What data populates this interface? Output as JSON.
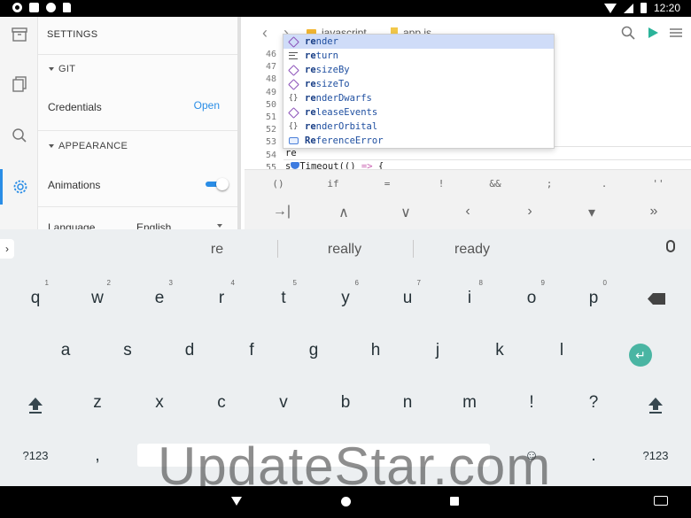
{
  "statusbar": {
    "time": "12:20",
    "icons": [
      "gear-icon",
      "box-icon",
      "circle-icon",
      "clipboard-icon",
      "wifi-icon",
      "cell-signal-icon",
      "battery-icon"
    ]
  },
  "rail": {
    "items": [
      "archive-icon",
      "files-icon",
      "search-icon",
      "settings-icon"
    ],
    "active": "settings-icon",
    "accent": "#2a8de6"
  },
  "settings": {
    "title": "SETTINGS",
    "git_header": "GIT",
    "credentials_label": "Credentials",
    "credentials_action": "Open",
    "appearance_header": "APPEARANCE",
    "animations_label": "Animations",
    "animations_on": true,
    "language_label": "Language",
    "language_value": "English"
  },
  "editor": {
    "breadcrumbs": [
      "javascript",
      "app.js"
    ],
    "line_numbers": [
      "46",
      "47",
      "48",
      "49",
      "50",
      "51",
      "52",
      "53",
      "54",
      "55"
    ],
    "current_line": "re",
    "next_line_suffix": "Timeout(() => {",
    "next_line_arrow": "=>",
    "autocomplete": [
      {
        "label": "render",
        "kind": "method"
      },
      {
        "label": "return",
        "kind": "keyword"
      },
      {
        "label": "resizeBy",
        "kind": "method"
      },
      {
        "label": "resizeTo",
        "kind": "method"
      },
      {
        "label": "renderDwarfs",
        "kind": "snippet"
      },
      {
        "label": "releaseEvents",
        "kind": "method"
      },
      {
        "label": "renderOrbital",
        "kind": "snippet"
      },
      {
        "label": "ReferenceError",
        "kind": "class"
      }
    ]
  },
  "symbols": [
    "()",
    "if",
    "=",
    "!",
    "&&",
    ";",
    ".",
    "''"
  ],
  "nav_keys": [
    "→|",
    "∧",
    "∨",
    "‹",
    "›",
    "▾",
    "»"
  ],
  "keyboard": {
    "suggestions": [
      "re",
      "really",
      "ready"
    ],
    "row1": [
      {
        "k": "q",
        "h": "1"
      },
      {
        "k": "w",
        "h": "2"
      },
      {
        "k": "e",
        "h": "3"
      },
      {
        "k": "r",
        "h": "4"
      },
      {
        "k": "t",
        "h": "5"
      },
      {
        "k": "y",
        "h": "6"
      },
      {
        "k": "u",
        "h": "7"
      },
      {
        "k": "i",
        "h": "8"
      },
      {
        "k": "o",
        "h": "9"
      },
      {
        "k": "p",
        "h": "0"
      }
    ],
    "row2": [
      "a",
      "s",
      "d",
      "f",
      "g",
      "h",
      "j",
      "k",
      "l"
    ],
    "row3": [
      "z",
      "x",
      "c",
      "v",
      "b",
      "n",
      "m",
      "!",
      "?"
    ],
    "row4_left": "?123",
    "row4_comma": ",",
    "row4_period": ".",
    "row4_right": "?123",
    "enter_color": "#4ab5a3"
  },
  "watermark": "UpdateStar.com"
}
